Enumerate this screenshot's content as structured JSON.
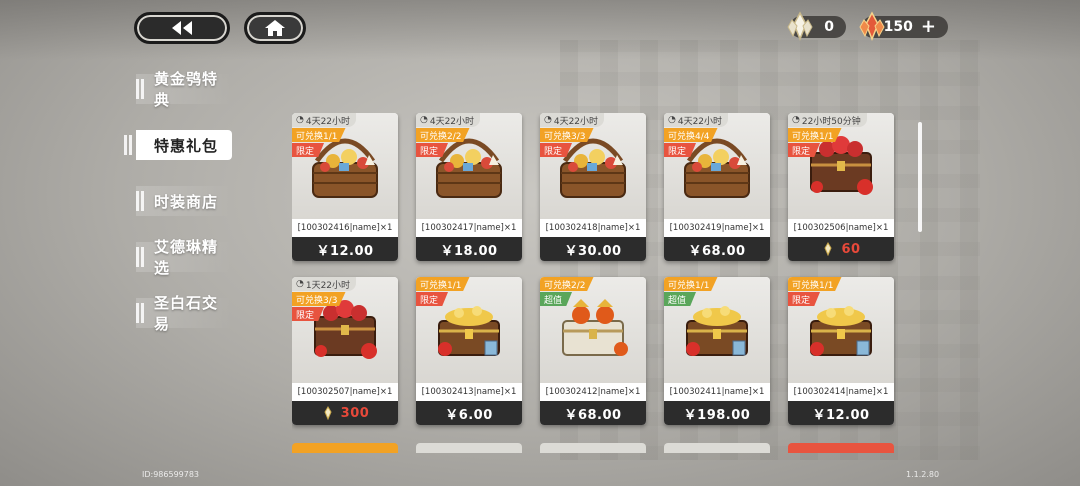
{
  "nav": {
    "back_icon": "double-chevron-left-icon",
    "home_icon": "home-icon"
  },
  "currency": [
    {
      "icon": "white-crystal-icon",
      "value": "0"
    },
    {
      "icon": "red-crystal-icon",
      "value": "150",
      "plus": "+"
    }
  ],
  "sidebar": {
    "items": [
      {
        "label": "黄金鸮特典",
        "active": false
      },
      {
        "label": "特惠礼包",
        "active": true
      },
      {
        "label": "时装商店",
        "active": false
      },
      {
        "label": "艾德琳精选",
        "active": false
      },
      {
        "label": "圣白石交易",
        "active": false
      }
    ]
  },
  "cards": [
    {
      "timer": "4天22小时",
      "limit": "可兑换1/1",
      "tag": "限定",
      "tag_type": "limited",
      "name": "[100302416|name]×1",
      "price": "￥12.00",
      "art": "basket"
    },
    {
      "timer": "4天22小时",
      "limit": "可兑换2/2",
      "tag": "限定",
      "tag_type": "limited",
      "name": "[100302417|name]×1",
      "price": "￥18.00",
      "art": "basket"
    },
    {
      "timer": "4天22小时",
      "limit": "可兑换3/3",
      "tag": "限定",
      "tag_type": "limited",
      "name": "[100302418|name]×1",
      "price": "￥30.00",
      "art": "basket"
    },
    {
      "timer": "4天22小时",
      "limit": "可兑换4/4",
      "tag": "限定",
      "tag_type": "limited",
      "name": "[100302419|name]×1",
      "price": "￥68.00",
      "art": "basket"
    },
    {
      "timer": "22小时50分钟",
      "limit": "可兑换1/1",
      "tag": "限定",
      "tag_type": "limited",
      "name": "[100302506|name]×1",
      "price": "60",
      "price_type": "stone",
      "art": "chest-red"
    },
    {
      "timer": "1天22小时",
      "limit": "可兑换3/3",
      "tag": "限定",
      "tag_type": "limited",
      "name": "[100302507|name]×1",
      "price": "300",
      "price_type": "stone",
      "art": "chest-red"
    },
    {
      "timer": "",
      "limit": "可兑换1/1",
      "tag": "限定",
      "tag_type": "limited",
      "name": "[100302413|name]×1",
      "price": "￥6.00",
      "art": "chest-gold"
    },
    {
      "timer": "",
      "limit": "可兑换2/2",
      "tag": "超值",
      "tag_type": "super",
      "name": "[100302412|name]×1",
      "price": "￥68.00",
      "art": "chest-gem"
    },
    {
      "timer": "",
      "limit": "可兑换1/1",
      "tag": "超值",
      "tag_type": "super",
      "name": "[100302411|name]×1",
      "price": "￥198.00",
      "art": "chest-gold"
    },
    {
      "timer": "",
      "limit": "可兑换1/1",
      "tag": "限定",
      "tag_type": "limited",
      "name": "[100302414|name]×1",
      "price": "￥12.00",
      "art": "chest-gold"
    }
  ],
  "footer": {
    "id": "ID:986599783",
    "version": "1.1.2.80"
  },
  "colors": {
    "limit": "#f2a224",
    "limited_tag": "#e8543f",
    "super_tag": "#5aa65a",
    "stone_price": "#e8493a",
    "price_bar": "#2c2c2c"
  }
}
